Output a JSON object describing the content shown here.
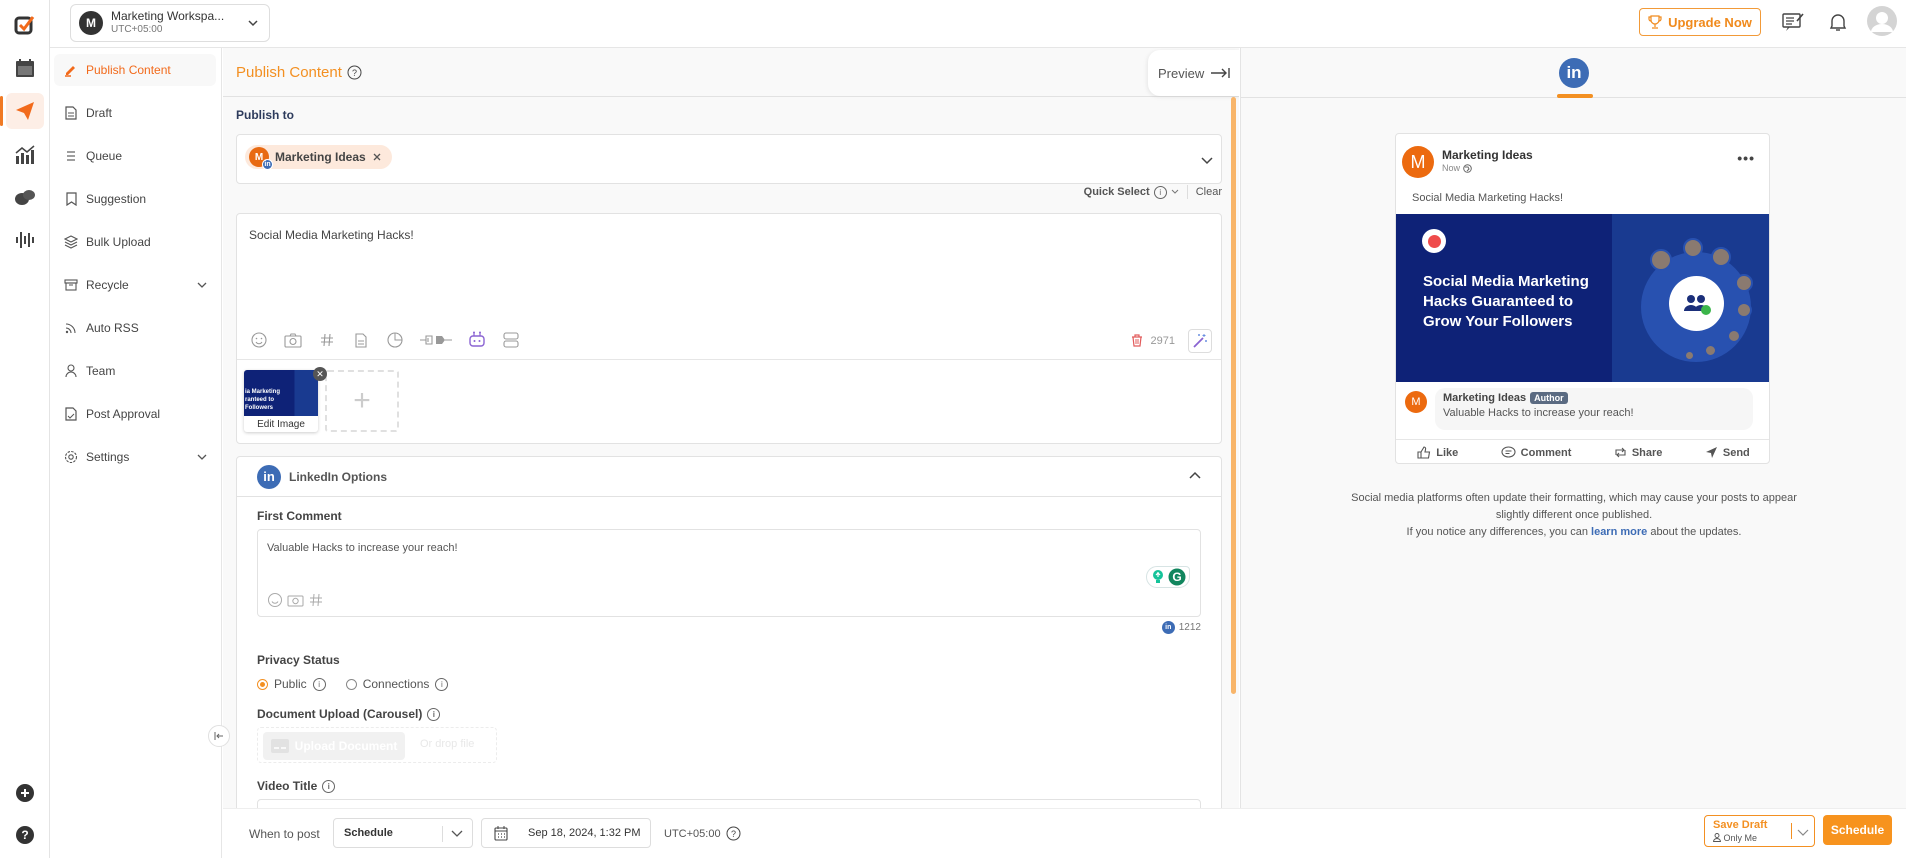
{
  "workspace": {
    "initial": "M",
    "name": "Marketing Workspa...",
    "timezone": "UTC+05:00"
  },
  "header": {
    "upgrade_label": "Upgrade Now"
  },
  "rail": {
    "items": [
      "logo",
      "calendar",
      "publish",
      "analytics",
      "inbox",
      "listening"
    ],
    "active": "publish"
  },
  "sidebar": {
    "items": [
      {
        "label": "Publish Content",
        "icon": "pencil-icon",
        "active": true
      },
      {
        "label": "Draft",
        "icon": "document-icon"
      },
      {
        "label": "Queue",
        "icon": "list-icon"
      },
      {
        "label": "Suggestion",
        "icon": "bookmark-icon"
      },
      {
        "label": "Bulk Upload",
        "icon": "layers-icon"
      },
      {
        "label": "Recycle",
        "icon": "archive-icon",
        "expandable": true
      },
      {
        "label": "Auto RSS",
        "icon": "rss-icon"
      },
      {
        "label": "Team",
        "icon": "user-icon"
      },
      {
        "label": "Post Approval",
        "icon": "approval-icon"
      },
      {
        "label": "Settings",
        "icon": "gear-icon",
        "expandable": true
      }
    ]
  },
  "editor": {
    "title": "Publish Content",
    "preview_label": "Preview",
    "publish_to_label": "Publish to",
    "selected_account": {
      "initial": "M",
      "name": "Marketing Ideas",
      "network": "LinkedIn"
    },
    "quick_select_label": "Quick Select",
    "clear_label": "Clear",
    "post_text": "Social Media Marketing Hacks!",
    "char_count": "2971",
    "thumb_text": "ia Marketing\nranteed to\nFollowers",
    "edit_image_label": "Edit Image",
    "add_media_symbol": "+"
  },
  "linkedin_options": {
    "title": "LinkedIn Options",
    "li_glyph": "in",
    "first_comment_label": "First Comment",
    "first_comment_value": "Valuable Hacks to increase your reach!",
    "comment_char_count": "1212",
    "privacy_label": "Privacy Status",
    "privacy_options": [
      {
        "label": "Public",
        "selected": true
      },
      {
        "label": "Connections",
        "selected": false
      }
    ],
    "document_upload_label": "Document Upload (Carousel)",
    "upload_document_label": "Upload Document",
    "drop_label": "Or drop file",
    "video_title_label": "Video Title"
  },
  "footer": {
    "when_label": "When to post",
    "when_value": "Schedule",
    "date_value": "Sep 18, 2024, 1:32 PM",
    "timezone": "UTC+05:00",
    "save_draft_label": "Save Draft",
    "save_draft_sub": "Only Me",
    "schedule_label": "Schedule"
  },
  "preview": {
    "tab_glyph": "in",
    "account_initial": "M",
    "account_name": "Marketing Ideas",
    "time": "Now",
    "more": "•••",
    "post_text": "Social Media Marketing Hacks!",
    "image_headline": "Social Media Marketing Hacks Guaranteed to Grow Your Followers",
    "comment_name": "Marketing Ideas",
    "comment_badge": "Author",
    "comment_text": "Valuable Hacks to increase your reach!",
    "actions": [
      "Like",
      "Comment",
      "Share",
      "Send"
    ],
    "note_line1": "Social media platforms often update their formatting, which may cause your posts to appear slightly different once published.",
    "note_line2_pre": "If you notice any differences, you can ",
    "note_link": "learn more",
    "note_line2_post": " about the updates."
  },
  "colors": {
    "accent": "#f39022",
    "linkedin": "#3d6cb5",
    "brand_orange": "#f26a1b"
  }
}
